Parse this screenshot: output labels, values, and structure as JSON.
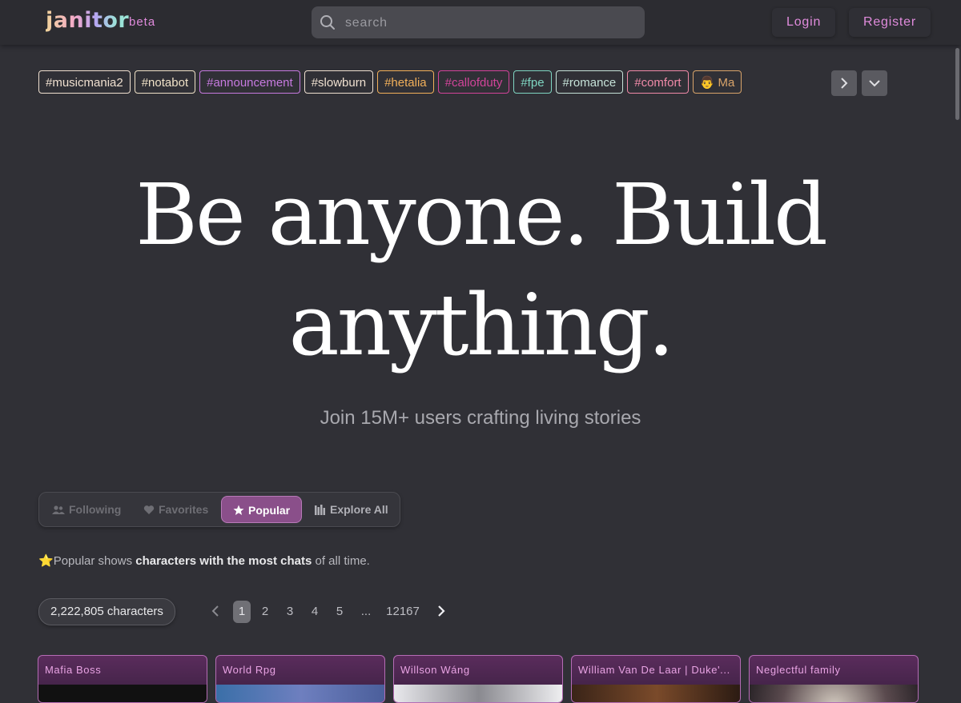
{
  "header": {
    "logo": "janitor",
    "badge": "beta",
    "search_placeholder": "search",
    "login": "Login",
    "register": "Register"
  },
  "tags": [
    {
      "label": "#musicmania2",
      "color": "#f0e0d0"
    },
    {
      "label": "#notabot",
      "color": "#f0e2c8"
    },
    {
      "label": "#announcement",
      "color": "#c77ae0"
    },
    {
      "label": "#slowburn",
      "color": "#efe0d0"
    },
    {
      "label": "#hetalia",
      "color": "#f2b05a"
    },
    {
      "label": "#callofduty",
      "color": "#d2449a"
    },
    {
      "label": "#fpe",
      "color": "#7fd6c2"
    },
    {
      "label": "#romance",
      "color": "#c6e2d8"
    },
    {
      "label": "#comfort",
      "color": "#f08aa8"
    },
    {
      "label": "👨 Ma",
      "color": "#d9a46a"
    }
  ],
  "hero": {
    "line1": "Be anyone. Build",
    "line2": "anything.",
    "subtitle": "Join 15M+ users crafting living stories"
  },
  "filters": {
    "following": "Following",
    "favorites": "Favorites",
    "popular": "Popular",
    "explore": "Explore All"
  },
  "note": {
    "emoji": "⭐",
    "prefix": "Popular shows ",
    "bold": "characters with the most chats",
    "suffix": " of all time."
  },
  "count": "2,222,805 characters",
  "pagination": {
    "pages": [
      "1",
      "2",
      "3",
      "4",
      "5",
      "...",
      "12167"
    ],
    "current": "1"
  },
  "cards": [
    {
      "title": "Mafia Boss"
    },
    {
      "title": "World Rpg"
    },
    {
      "title": "Willson Wáng"
    },
    {
      "title": "William Van De Laar | Duke'..."
    },
    {
      "title": "Neglectful family"
    }
  ],
  "colors": {
    "accent": "#e08bdc",
    "active_tab": "#8a4f8a",
    "background": "#303036"
  }
}
